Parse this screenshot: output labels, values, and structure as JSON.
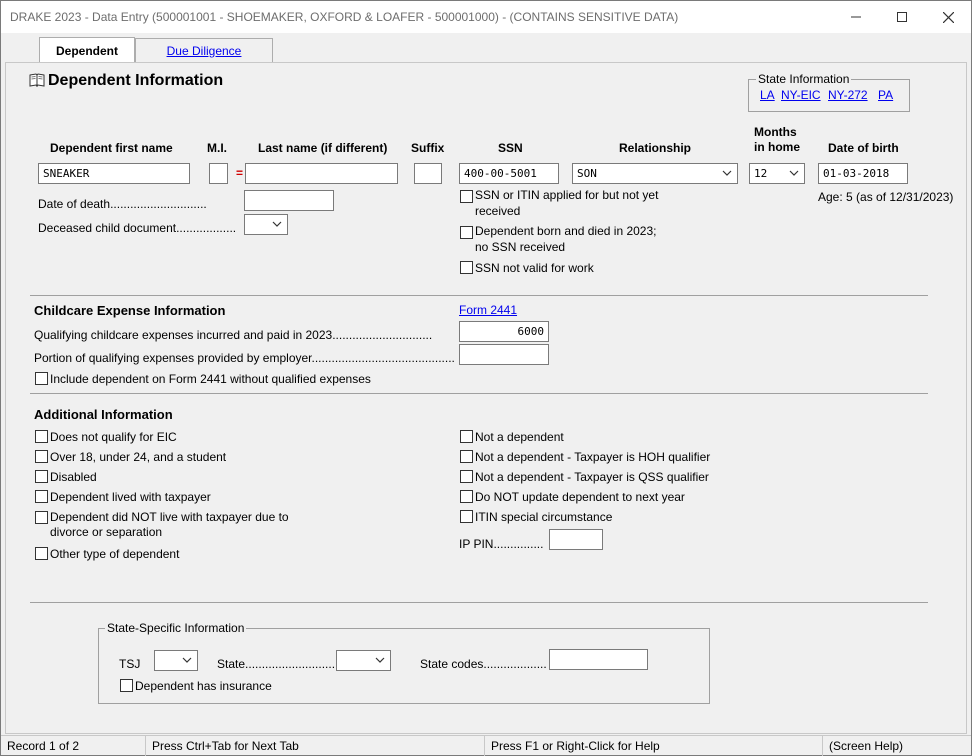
{
  "window": {
    "title": "DRAKE 2023 - Data Entry (500001001 - SHOEMAKER, OXFORD & LOAFER - 500001000) - (CONTAINS SENSITIVE DATA)",
    "minimize_icon": "minimize-icon",
    "maximize_icon": "maximize-icon",
    "close_icon": "close-icon"
  },
  "tabs": [
    {
      "label": "Dependent",
      "active": true
    },
    {
      "label": "Due Diligence",
      "active": false
    }
  ],
  "page": {
    "title": "Dependent Information",
    "book_icon": "book-icon"
  },
  "state_info": {
    "legend": "State Information",
    "links": [
      "LA",
      "NY-EIC",
      "NY-272",
      "PA"
    ]
  },
  "dependent": {
    "headers": {
      "first_name": "Dependent first name",
      "mi": "M.I.",
      "last_name": "Last name (if different)",
      "suffix": "Suffix",
      "ssn": "SSN",
      "relationship": "Relationship",
      "months_line1": "Months",
      "months_line2": "in home",
      "dob": "Date of birth"
    },
    "first_name": "SNEAKER",
    "mi": "",
    "equals_sign": "=",
    "last_name": "",
    "suffix": "",
    "ssn": "400-00-5001",
    "relationship": "SON",
    "months": "12",
    "dob": "01-03-2018",
    "age_text": "Age: 5 (as of 12/31/2023)",
    "date_of_death_label": "Date of death",
    "deceased_doc_label": "Deceased child document",
    "ssn_checks": [
      {
        "line1": "SSN or ITIN applied for but not yet",
        "line2": "received",
        "checked": false
      },
      {
        "line1": "Dependent born and died in 2023;",
        "line2": "no SSN received",
        "checked": false
      },
      {
        "line1": "SSN not valid for work",
        "line2": "",
        "checked": false
      }
    ]
  },
  "childcare": {
    "heading": "Childcare Expense Information",
    "form_link": "Form 2441",
    "qualifying_label": "Qualifying childcare expenses incurred and paid in 2023",
    "qualifying_value": "6000",
    "employer_label": "Portion of qualifying expenses provided by employer",
    "employer_value": "",
    "include_label": "Include dependent on Form 2441 without qualified expenses"
  },
  "additional": {
    "heading": "Additional Information",
    "left_checks": [
      {
        "line1": "Does not qualify for EIC",
        "line2": ""
      },
      {
        "line1": "Over 18, under 24, and a student",
        "line2": ""
      },
      {
        "line1": "Disabled",
        "line2": ""
      },
      {
        "line1": "Dependent lived with taxpayer",
        "line2": ""
      },
      {
        "line1": "Dependent did NOT live with taxpayer due to",
        "line2": "divorce or separation"
      },
      {
        "line1": "Other type of dependent",
        "line2": ""
      }
    ],
    "right_checks": [
      {
        "label": "Not a dependent"
      },
      {
        "label": "Not a dependent - Taxpayer is HOH qualifier"
      },
      {
        "label": "Not a dependent - Taxpayer is QSS qualifier"
      },
      {
        "label": "Do NOT update dependent to next year"
      },
      {
        "label": "ITIN special circumstance"
      }
    ],
    "ip_pin_label": "IP PIN",
    "ip_pin_value": ""
  },
  "state_specific": {
    "legend": "State-Specific Information",
    "tsj_label": "TSJ",
    "state_label": "State",
    "state_codes_label": "State codes",
    "insurance_label": "Dependent has insurance"
  },
  "status": {
    "record": "Record 1 of 2",
    "next_tab": "Press Ctrl+Tab for Next Tab",
    "help": "Press F1 or Right-Click for Help",
    "screen_help": "(Screen Help)"
  }
}
